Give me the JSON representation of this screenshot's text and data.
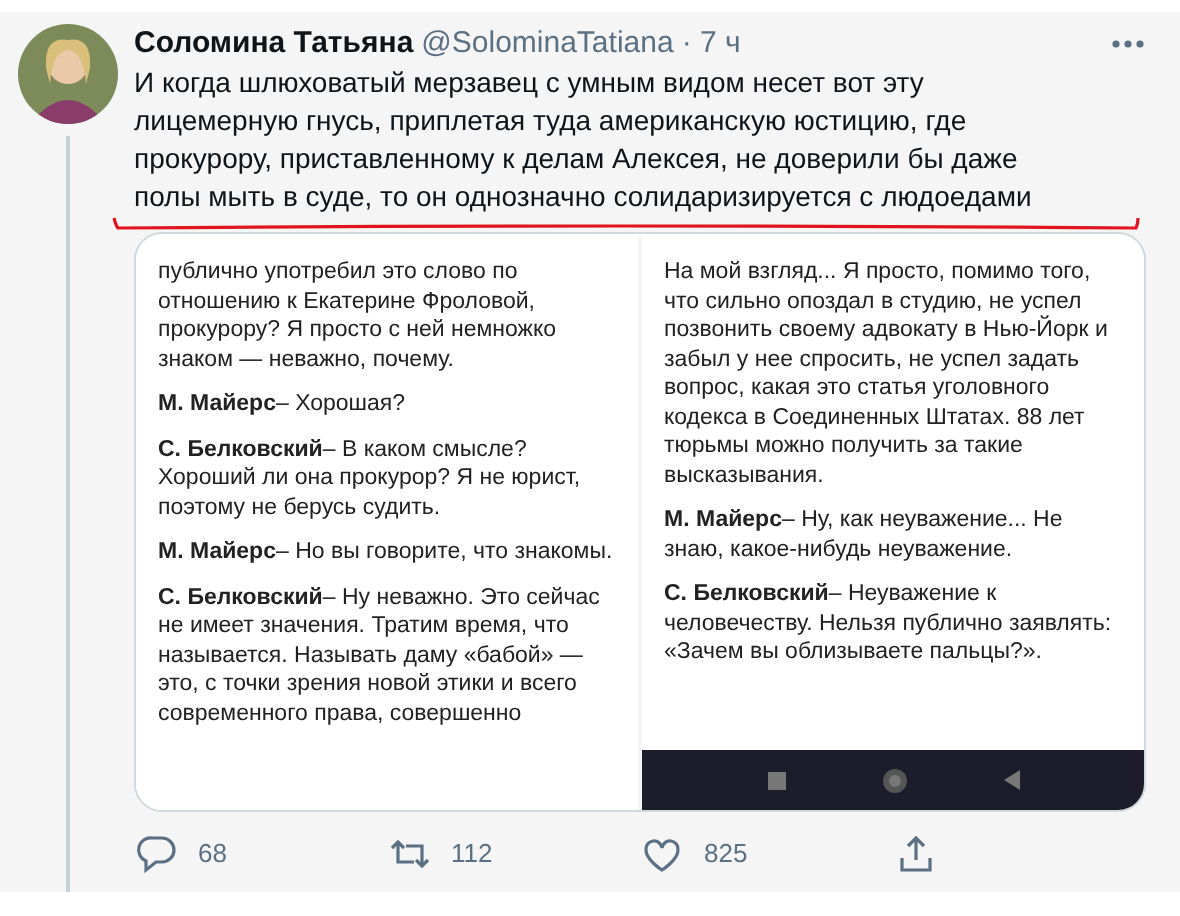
{
  "tweet": {
    "author": "Соломина Татьяна",
    "handle": "@SolominaTatiana",
    "time": "· 7 ч",
    "text_lines": [
      "И когда шлюховатый мерзавец с умным видом несет вот эту",
      "лицемерную гнусь, приплетая туда американскую юстицию, где",
      "прокурору, приставленному к делам Алексея, не доверили бы даже",
      "полы мыть в суде, то он однозначно солидаризируется с людоедами"
    ]
  },
  "media": [
    {
      "paragraphs": [
        "публично употребил это слово по отношению к Екатерине Фроловой, прокурору? Я просто с ней немножко знаком — неважно, почему.",
        "**М. Майерс**– Хорошая?",
        "**С. Белковский**– В каком смысле? Хороший ли она прокурор? Я не юрист, поэтому не берусь судить.",
        "**М. Майерс**– Но вы говорите, что знакомы.",
        "**С. Белковский**– Ну неважно. Это сейчас не имеет значения. Тратим время, что называется. Называть даму «бабой» — это, с точки зрения новой этики и всего современного права, совершенно"
      ],
      "nav_bar": false
    },
    {
      "paragraphs": [
        "На мой взгляд... Я просто, помимо того, что сильно опоздал в студию, не успел позвонить своему адвокату в Нью-Йорк и забыл у нее спросить, не успел задать вопрос, какая это статья уголовного кодекса в Соединенных Штатах. 88 лет тюрьмы можно получить за такие высказывания.",
        "**М. Майерс**– Ну, как неуважение... Не знаю, какое-нибудь неуважение.",
        "**С. Белковский**– Неуважение к человечеству. Нельзя публично заявлять: «Зачем вы облизываете пальцы?»."
      ],
      "nav_bar": true
    }
  ],
  "actions": [
    {
      "kind": "reply",
      "count": "68"
    },
    {
      "kind": "retweet",
      "count": "112"
    },
    {
      "kind": "like",
      "count": "825"
    },
    {
      "kind": "share"
    }
  ]
}
